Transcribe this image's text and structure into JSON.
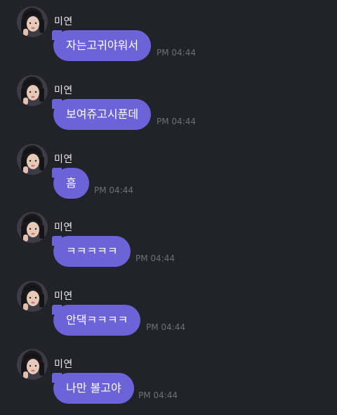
{
  "messages": [
    {
      "sender": "미연",
      "text": "자는고귀야워서",
      "time": "PM 04:44"
    },
    {
      "sender": "미연",
      "text": "보여쥬고시푼데",
      "time": "PM 04:44"
    },
    {
      "sender": "미연",
      "text": "흠",
      "time": "PM 04:44"
    },
    {
      "sender": "미연",
      "text": "ㅋㅋㅋㅋㅋ",
      "time": "PM 04:44"
    },
    {
      "sender": "미연",
      "text": "안댁ㅋㅋㅋㅋ",
      "time": "PM 04:44"
    },
    {
      "sender": "미연",
      "text": "나만 볼고야",
      "time": "PM 04:44"
    }
  ],
  "colors": {
    "background": "#222229",
    "bubble": "#6c63d8",
    "time": "#6f6f78"
  }
}
